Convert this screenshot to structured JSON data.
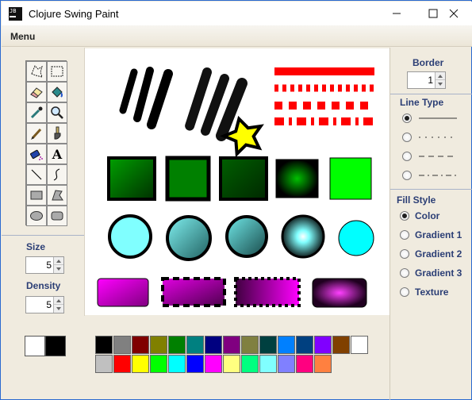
{
  "window": {
    "title": "Clojure Swing Paint",
    "icon_text": "JB",
    "controls": [
      "minimize-icon",
      "maximize-icon",
      "close-icon"
    ]
  },
  "menubar": {
    "menu_label": "Menu"
  },
  "tools": [
    "freeform-select-icon",
    "rect-select-icon",
    "eraser-icon",
    "fill-bucket-icon",
    "eyedropper-icon",
    "magnifier-icon",
    "pencil-icon",
    "brush-icon",
    "airbrush-icon",
    "text-icon",
    "line-icon",
    "curve-icon",
    "rectangle-icon",
    "polygon-icon",
    "ellipse-icon",
    "rounded-rect-icon"
  ],
  "tool_text_glyph": "A",
  "left": {
    "size_label": "Size",
    "size_value": "5",
    "density_label": "Density",
    "density_value": "5"
  },
  "right": {
    "border_label": "Border",
    "border_value": "1",
    "line_type_label": "Line Type",
    "line_types": [
      "solid",
      "dotted",
      "dashed",
      "dash-dot"
    ],
    "line_type_selected": 0,
    "fill_style_label": "Fill Style",
    "fill_styles": [
      "Color",
      "Gradient 1",
      "Gradient 2",
      "Gradient 3",
      "Texture"
    ],
    "fill_style_selected": 0
  },
  "current_colors": {
    "primary": "#ffffff",
    "secondary": "#000000"
  },
  "palette": [
    "#000000",
    "#808080",
    "#800000",
    "#808000",
    "#008000",
    "#008080",
    "#000080",
    "#800080",
    "#808040",
    "#004040",
    "#0080ff",
    "#004080",
    "#8000ff",
    "#804000",
    "#ffffff",
    "#c0c0c0",
    "#ff0000",
    "#ffff00",
    "#00ff00",
    "#00ffff",
    "#0000ff",
    "#ff00ff",
    "#ffff80",
    "#00ff80",
    "#80ffff",
    "#8080ff",
    "#ff0080",
    "#ff8040"
  ],
  "canvas": {
    "background": "#ffffff"
  }
}
